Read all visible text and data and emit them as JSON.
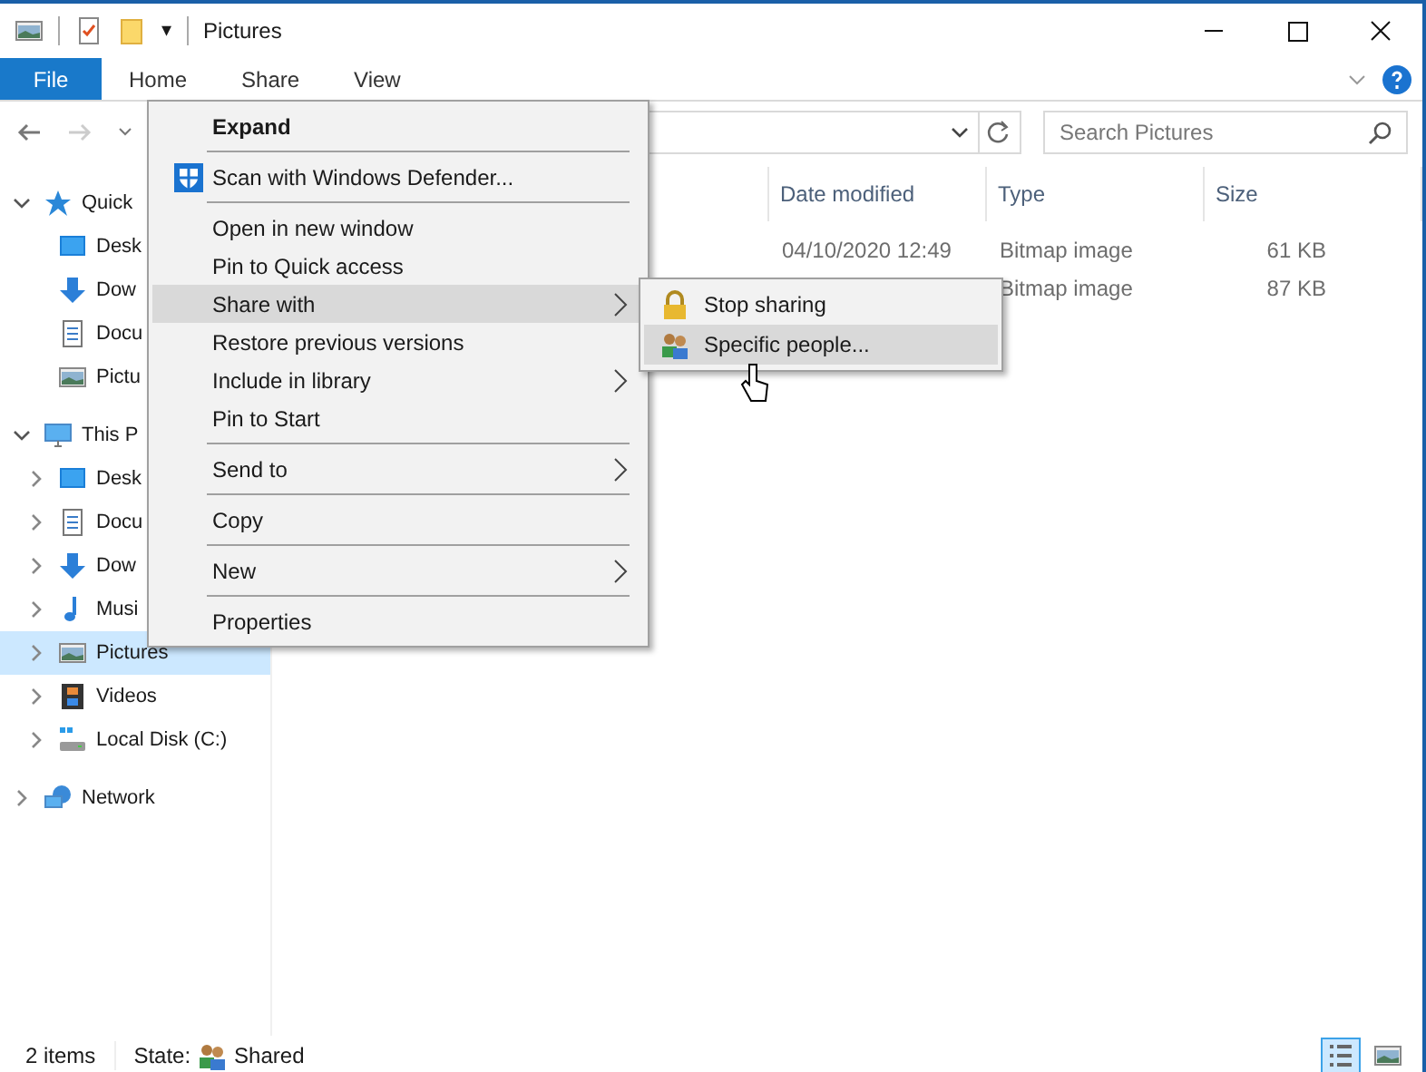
{
  "window": {
    "title": "Pictures",
    "quick_access_toolbar": {
      "customize_glyph": "▾"
    }
  },
  "ribbon": {
    "tabs": [
      {
        "label": "File",
        "kind": "file",
        "selected": false
      },
      {
        "label": "Home",
        "kind": "tab",
        "selected": false
      },
      {
        "label": "Share",
        "kind": "tab",
        "selected": false
      },
      {
        "label": "View",
        "kind": "tab",
        "selected": false
      }
    ]
  },
  "search": {
    "placeholder": "Search Pictures"
  },
  "columns": [
    {
      "label": "Date modified"
    },
    {
      "label": "Type"
    },
    {
      "label": "Size"
    }
  ],
  "files": [
    {
      "date_modified": "04/10/2020 12:49",
      "type": "Bitmap image",
      "size": "61 KB"
    },
    {
      "type": "Bitmap image",
      "size": "87 KB"
    }
  ],
  "sidebar": {
    "items": [
      {
        "label": "Quick",
        "kind": "star",
        "expanded": true,
        "selected": false,
        "children": [
          {
            "label": "Desk",
            "kind": "desktop",
            "selected": false
          },
          {
            "label": "Dow",
            "kind": "download",
            "selected": false
          },
          {
            "label": "Docu",
            "kind": "document",
            "selected": false
          },
          {
            "label": "Pictu",
            "kind": "picture",
            "selected": false
          }
        ]
      },
      {
        "label": "This P",
        "kind": "pc",
        "expanded": true,
        "selected": false,
        "children": [
          {
            "label": "Desk",
            "kind": "desktop",
            "expanded": false,
            "selected": false
          },
          {
            "label": "Docu",
            "kind": "document",
            "expanded": false,
            "selected": false
          },
          {
            "label": "Dow",
            "kind": "download",
            "expanded": false,
            "selected": false
          },
          {
            "label": "Musi",
            "kind": "music",
            "expanded": false,
            "selected": false
          },
          {
            "label": "Pictures",
            "kind": "picture",
            "expanded": false,
            "selected": true
          },
          {
            "label": "Videos",
            "kind": "video",
            "expanded": false,
            "selected": false
          },
          {
            "label": "Local Disk (C:)",
            "kind": "disk",
            "expanded": false,
            "selected": false
          }
        ]
      },
      {
        "label": "Network",
        "kind": "network",
        "expanded": false,
        "selected": false
      }
    ]
  },
  "context_menu": {
    "items": [
      {
        "kind": "item",
        "label": "Expand",
        "bold": true,
        "submenu": false,
        "selected": false
      },
      {
        "kind": "separator"
      },
      {
        "kind": "shield_item",
        "label": "Scan with Windows Defender...",
        "bold": false,
        "submenu": false,
        "selected": false
      },
      {
        "kind": "separator"
      },
      {
        "kind": "item",
        "label": "Open in new window",
        "bold": false,
        "submenu": false,
        "selected": false
      },
      {
        "kind": "item",
        "label": "Pin to Quick access",
        "bold": false,
        "submenu": false,
        "selected": false
      },
      {
        "kind": "item",
        "label": "Share with",
        "bold": false,
        "submenu": true,
        "selected": true
      },
      {
        "kind": "item",
        "label": "Restore previous versions",
        "bold": false,
        "submenu": false,
        "selected": false
      },
      {
        "kind": "item",
        "label": "Include in library",
        "bold": false,
        "submenu": true,
        "selected": false
      },
      {
        "kind": "item",
        "label": "Pin to Start",
        "bold": false,
        "submenu": false,
        "selected": false
      },
      {
        "kind": "separator"
      },
      {
        "kind": "item",
        "label": "Send to",
        "bold": false,
        "submenu": true,
        "selected": false
      },
      {
        "kind": "separator"
      },
      {
        "kind": "item",
        "label": "Copy",
        "bold": false,
        "submenu": false,
        "selected": false
      },
      {
        "kind": "separator"
      },
      {
        "kind": "item",
        "label": "New",
        "bold": false,
        "submenu": true,
        "selected": false
      },
      {
        "kind": "separator"
      },
      {
        "kind": "item",
        "label": "Properties",
        "bold": false,
        "submenu": false,
        "selected": false
      }
    ]
  },
  "submenu": {
    "items": [
      {
        "label": "Stop sharing",
        "kind": "lock",
        "selected": false
      },
      {
        "label": "Specific people...",
        "kind": "people",
        "selected": true
      }
    ]
  },
  "status_bar": {
    "count": "2 items",
    "state_label": "State:",
    "state_value": "Shared",
    "views": [
      {
        "kind": "details",
        "selected": true
      },
      {
        "kind": "thumbnails",
        "selected": false
      }
    ]
  }
}
